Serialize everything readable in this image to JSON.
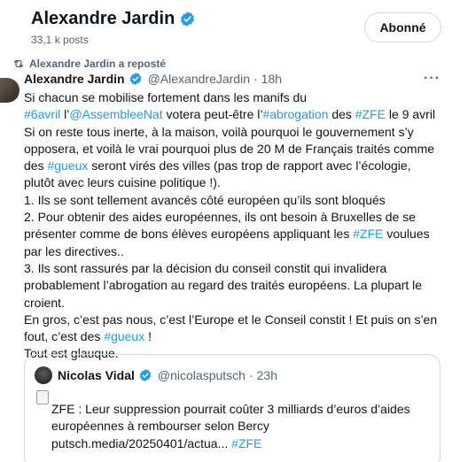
{
  "profile": {
    "name": "Alexandre Jardin",
    "posts": "33,1 k posts",
    "follow_label": "Abonné"
  },
  "repost": {
    "label": "Alexandre Jardin a reposté",
    "icon": "repost-icon"
  },
  "tweet": {
    "author": "Alexandre Jardin",
    "handle": "@AlexandreJardin",
    "separator": "·",
    "time": "18h",
    "more": "···",
    "lines": [
      [
        {
          "t": "Si chacun se mobilise fortement dans les manifs du"
        }
      ],
      [
        {
          "t": "#6avril",
          "link": true
        },
        {
          "t": " l’"
        },
        {
          "t": "@AssembleeNat",
          "link": true
        },
        {
          "t": " votera peut-être l’"
        },
        {
          "t": "#abrogation",
          "link": true
        },
        {
          "t": " des "
        },
        {
          "t": "#ZFE",
          "link": true
        },
        {
          "t": " le 9 avril"
        }
      ],
      [
        {
          "t": "Si on reste tous inerte, à la maison, voilà pourquoi le gouvernement s’y"
        }
      ],
      [
        {
          "t": "opposera, et voilà le vrai pourquoi plus de 20 M de Français traités comme"
        }
      ],
      [
        {
          "t": "des "
        },
        {
          "t": "#gueux",
          "link": true
        },
        {
          "t": " seront virés des villes (pas trop de rapport avec l’écologie,"
        }
      ],
      [
        {
          "t": "plutôt avec leurs cuisine politique !)."
        }
      ],
      [
        {
          "t": "1. Ils se sont tellement avancés côté européen qu’ils sont bloqués"
        }
      ],
      [
        {
          "t": "2. Pour obtenir des aides européennes, ils ont besoin à Bruxelles de se"
        }
      ],
      [
        {
          "t": "présenter comme de bons élèves européens appliquant les "
        },
        {
          "t": "#ZFE",
          "link": true
        },
        {
          "t": " voulues"
        }
      ],
      [
        {
          "t": "par les  directives.."
        }
      ],
      [
        {
          "t": "3. Ils sont rassurés par la décision du conseil constit qui invalidera"
        }
      ],
      [
        {
          "t": "probablement l’abrogation au regard des traités européens. La plupart le"
        }
      ],
      [
        {
          "t": "croient."
        }
      ],
      [
        {
          "t": "En gros, c’est pas nous, c’est l’Europe et le Conseil constit ! Et puis on s’en"
        }
      ],
      [
        {
          "t": "fout, c’est des "
        },
        {
          "t": "#gueux",
          "link": true
        },
        {
          "t": " !"
        }
      ],
      [
        {
          "t": "Tout est glauque."
        }
      ]
    ]
  },
  "quote": {
    "author": "Nicolas Vidal",
    "handle": "@nicolasputsch",
    "separator": "·",
    "time": "23h",
    "lines": [
      [
        {
          "t": "ZFE : Leur suppression pourrait coûter 3 milliards d’euros d’aides"
        }
      ],
      [
        {
          "t": "européennes à rembourser selon Bercy"
        }
      ],
      [
        {
          "t": "putsch.media/20250401/actua... "
        },
        {
          "t": "#ZFE",
          "link": true
        }
      ]
    ]
  },
  "colors": {
    "link": "#1d9bf0",
    "verified": "#1d9bf0",
    "secondary_text": "#536471"
  }
}
